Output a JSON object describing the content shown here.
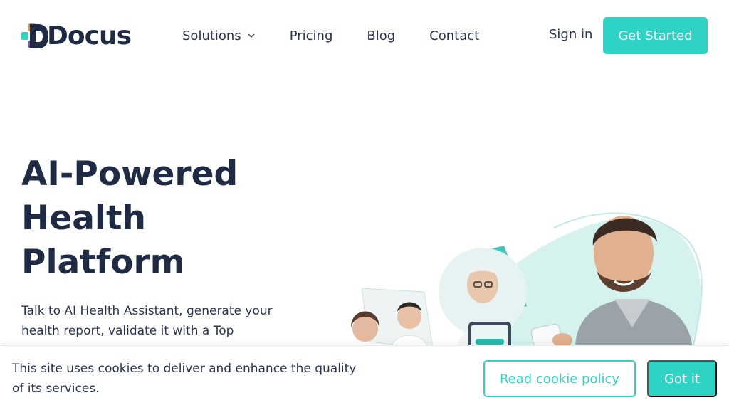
{
  "brand": {
    "name": "Docus",
    "accent_color": "#2ed3c6",
    "text_color": "#1f2a44",
    "logo_colors": [
      "#2ed3c6",
      "#f7941d",
      "#7b4fd6",
      "#1f2a44"
    ]
  },
  "nav": {
    "items": [
      {
        "label": "Solutions",
        "has_dropdown": true,
        "icon": "chevron-down-icon"
      },
      {
        "label": "Pricing"
      },
      {
        "label": "Blog"
      },
      {
        "label": "Contact"
      }
    ],
    "sign_in": "Sign in",
    "get_started": "Get Started"
  },
  "hero": {
    "title": "AI-Powered Health Platform",
    "subtitle": "Talk to AI Health Assistant, generate your health report, validate it with a Top"
  },
  "cookie_banner": {
    "text": "This site uses cookies to deliver and enhance the quality of its services.",
    "read_policy": "Read cookie policy",
    "accept": "Got it"
  }
}
